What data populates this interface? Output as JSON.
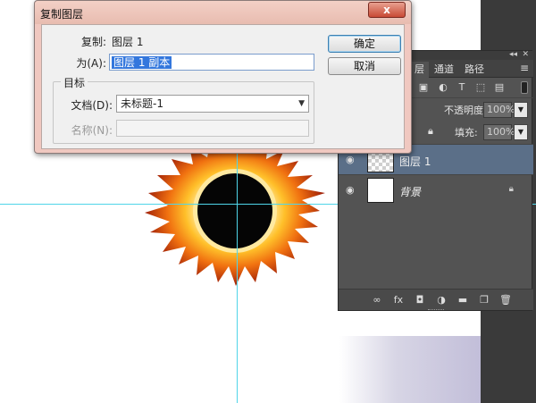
{
  "dialog": {
    "title": "复制图层",
    "close_glyph": "x",
    "duplicate_label": "复制:",
    "duplicate_value": "图层 1",
    "as_label": "为(A):",
    "as_value": "图层 1 副本",
    "destination_title": "目标",
    "document_label": "文档(D):",
    "document_value": "未标题-1",
    "name_label": "名称(N):",
    "name_value": "",
    "ok_label": "确定",
    "cancel_label": "取消"
  },
  "layers_panel": {
    "tabs": [
      {
        "label": "层"
      },
      {
        "label": "通道"
      },
      {
        "label": "路径"
      }
    ],
    "menu_glyph": "≡",
    "opacity_label": "不透明度:",
    "opacity_value": "100%",
    "fill_label": "填充:",
    "fill_value": "100%",
    "layers": [
      {
        "name": "图层 1",
        "selected": true
      },
      {
        "name": "背景",
        "selected": false
      }
    ],
    "bottom_fx": "fx"
  },
  "colors": {
    "guide": "#4fd5e8",
    "selected_layer": "#5b6f88",
    "dialog_frame": "#f0c8c0",
    "close_button": "#c84a35"
  }
}
